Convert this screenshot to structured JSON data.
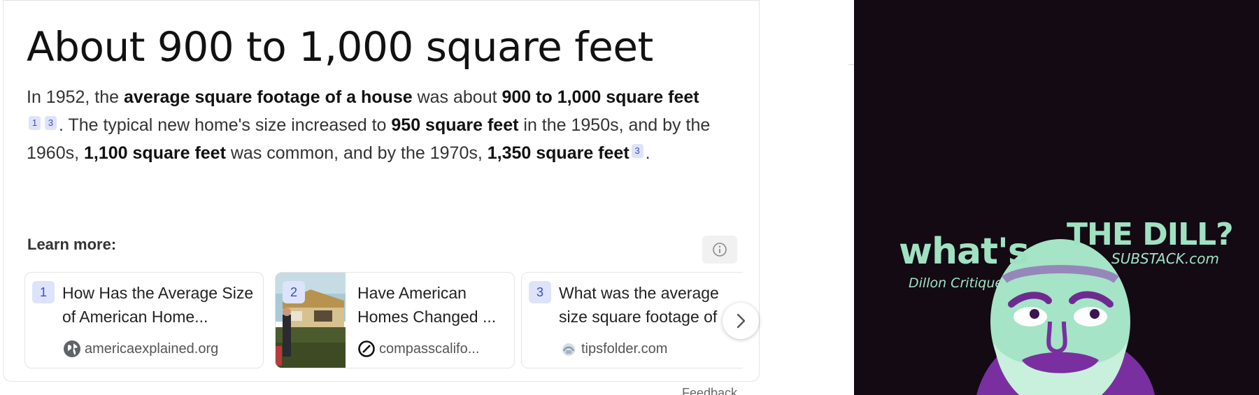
{
  "answer": {
    "title": "About 900 to 1,000 square feet",
    "body": {
      "s1_a": "In 1952, the ",
      "s1_b": "average square footage of a house",
      "s1_c": " was about ",
      "s1_d": "900 to 1,000 square feet",
      "cite_1": "1",
      "cite_2": "3",
      "s2_a": ". The typical new home's size increased to ",
      "s2_b": "950 square feet",
      "s2_c": " in the 1950s, and by the 1960s, ",
      "s2_d": "1,100 square feet",
      "s2_e": " was common, and by the 1970s, ",
      "s2_f": "1,350 square feet",
      "cite_3": "3",
      "s2_g": "."
    }
  },
  "learn_more": {
    "label": "Learn more:",
    "info_icon": "info-icon",
    "sources": [
      {
        "number": "1",
        "title": "How Has the Average Size of American Home...",
        "domain": "americaexplained.org",
        "favicon": "globe-icon"
      },
      {
        "number": "2",
        "title": "Have American Homes Changed ...",
        "domain": "compasscalifo...",
        "favicon": "compass-icon"
      },
      {
        "number": "3",
        "title": "What was the average size square footage of",
        "domain": "tipsfolder.com",
        "favicon": "tipsfolder-icon"
      }
    ],
    "next_icon": "chevron-right-icon"
  },
  "feedback_label": "Feedback",
  "promo": {
    "whats": "what's",
    "the_dill": "THE DILL?",
    "substack": "SUBSTACK.com",
    "byline": "Dillon Critique",
    "colors": {
      "background": "#130a14",
      "accent_green": "#9fe2c2",
      "accent_purple": "#7a2fa0"
    }
  },
  "colors": {
    "citation_bg": "#dde3fb",
    "citation_text": "#3a4fbf",
    "card_border": "#e4e4e4"
  }
}
